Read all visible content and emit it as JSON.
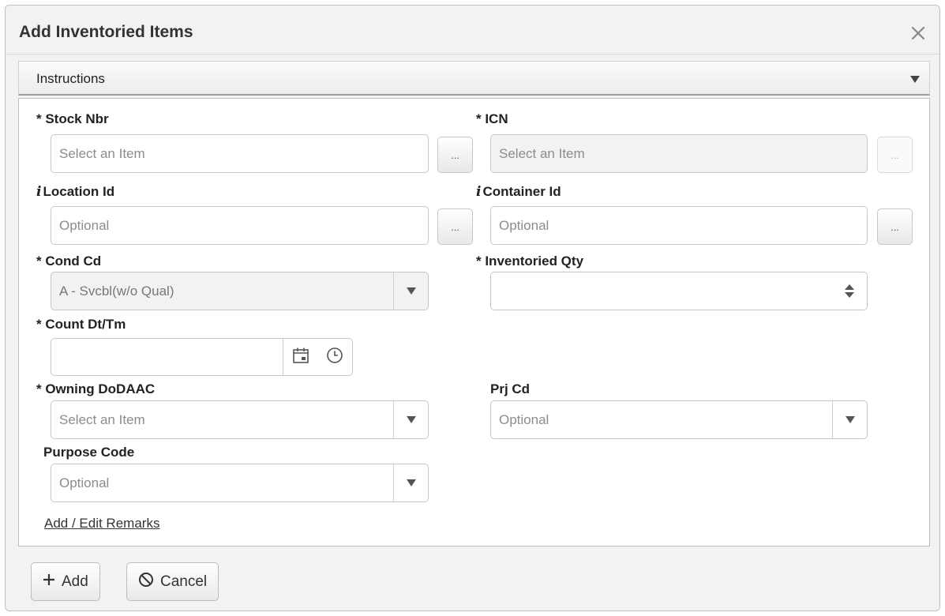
{
  "dialog": {
    "title": "Add Inventoried Items",
    "close_icon": "close-icon"
  },
  "instructions": {
    "label": "Instructions"
  },
  "form": {
    "stock_nbr": {
      "label": "* Stock Nbr",
      "placeholder": "Select an Item"
    },
    "icn": {
      "label": "* ICN",
      "placeholder": "Select an Item"
    },
    "location_id": {
      "label": "Location Id",
      "placeholder": "Optional"
    },
    "container_id": {
      "label": "Container Id",
      "placeholder": "Optional"
    },
    "cond_cd": {
      "label": "* Cond Cd",
      "value": "A - Svcbl(w/o Qual)"
    },
    "inventoried_qty": {
      "label": "* Inventoried Qty",
      "value": ""
    },
    "count_dt_tm": {
      "label": "* Count Dt/Tm",
      "value": ""
    },
    "owning_dodaac": {
      "label": "* Owning DoDAAC",
      "placeholder": "Select an Item"
    },
    "prj_cd": {
      "label": "Prj Cd",
      "placeholder": "Optional"
    },
    "purpose_code": {
      "label": "Purpose Code",
      "placeholder": "Optional"
    },
    "ellipsis": "...",
    "info_glyph": "i",
    "remarks_link": "Add / Edit Remarks"
  },
  "footer": {
    "add_label": "Add",
    "cancel_label": "Cancel"
  },
  "colors": {
    "panel_bg": "#f2f2f2",
    "border": "#c7c7c7",
    "text": "#222222"
  }
}
